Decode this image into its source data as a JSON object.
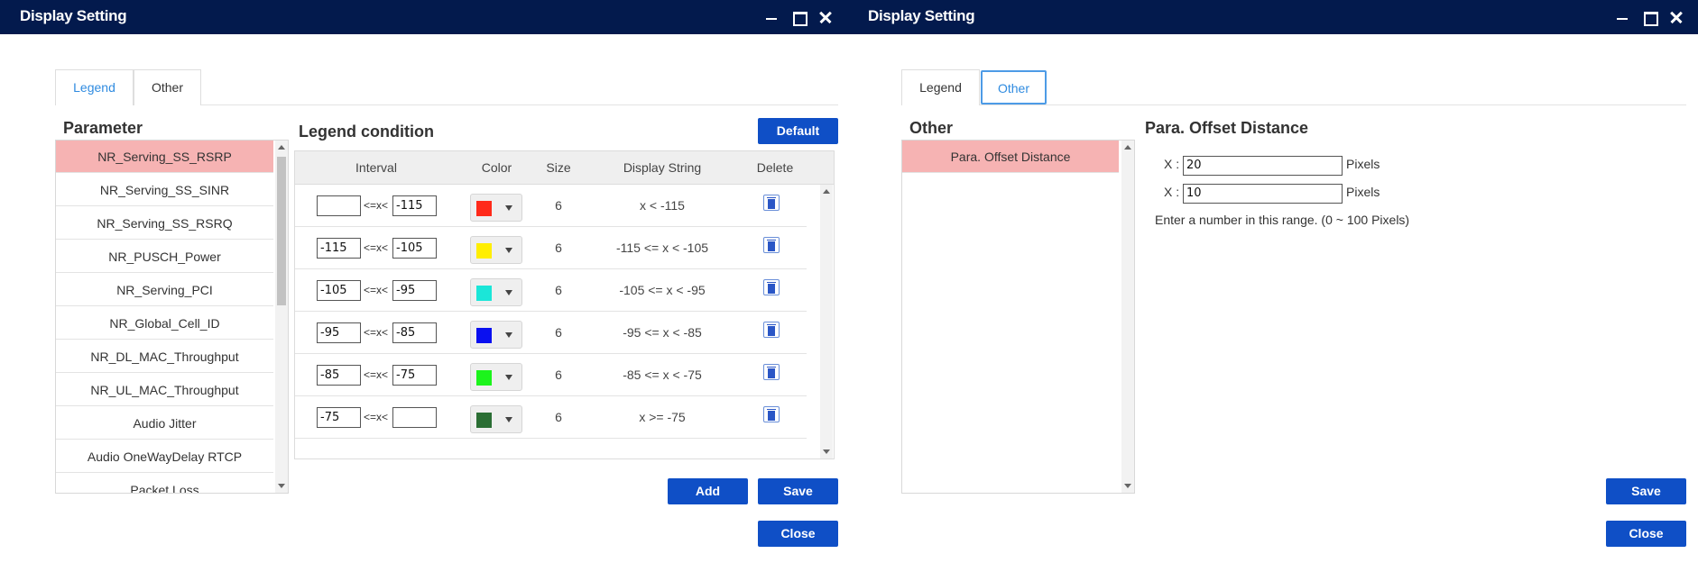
{
  "left_window": {
    "title": "Display Setting",
    "tabs": [
      {
        "label": "Legend"
      },
      {
        "label": "Other"
      }
    ],
    "parameter": {
      "heading": "Parameter",
      "items": [
        {
          "label": "NR_Serving_SS_RSRP"
        },
        {
          "label": "NR_Serving_SS_SINR"
        },
        {
          "label": "NR_Serving_SS_RSRQ"
        },
        {
          "label": "NR_PUSCH_Power"
        },
        {
          "label": "NR_Serving_PCI"
        },
        {
          "label": "NR_Global_Cell_ID"
        },
        {
          "label": "NR_DL_MAC_Throughput"
        },
        {
          "label": "NR_UL_MAC_Throughput"
        },
        {
          "label": "Audio Jitter"
        },
        {
          "label": "Audio OneWayDelay RTCP"
        },
        {
          "label": "Packet Loss"
        }
      ],
      "selected_index": 0
    },
    "legend": {
      "heading": "Legend condition",
      "default_label": "Default",
      "columns": {
        "interval": "Interval",
        "color": "Color",
        "size": "Size",
        "display": "Display String",
        "delete": "Delete"
      },
      "operator": "<=x<",
      "rows": [
        {
          "from": "",
          "to": "-115",
          "color": "#ff2a1a",
          "size": "6",
          "display": "x < -115"
        },
        {
          "from": "-115",
          "to": "-105",
          "color": "#ffee00",
          "size": "6",
          "display": "-115 <= x < -105"
        },
        {
          "from": "-105",
          "to": "-95",
          "color": "#1be6d8",
          "size": "6",
          "display": "-105 <= x < -95"
        },
        {
          "from": "-95",
          "to": "-85",
          "color": "#0a10f0",
          "size": "6",
          "display": "-95 <= x < -85"
        },
        {
          "from": "-85",
          "to": "-75",
          "color": "#1cf41c",
          "size": "6",
          "display": "-85 <= x < -75"
        },
        {
          "from": "-75",
          "to": "",
          "color": "#2b6e34",
          "size": "6",
          "display": "x >= -75"
        }
      ]
    },
    "buttons": {
      "add": "Add",
      "save": "Save",
      "close": "Close"
    }
  },
  "right_window": {
    "title": "Display Setting",
    "tabs": [
      {
        "label": "Legend"
      },
      {
        "label": "Other"
      }
    ],
    "other": {
      "heading": "Other",
      "items": [
        {
          "label": "Para. Offset Distance"
        }
      ]
    },
    "offset": {
      "heading": "Para. Offset Distance",
      "x_label": "X :",
      "fields": [
        {
          "value": "20",
          "unit": "Pixels"
        },
        {
          "value": "10",
          "unit": "Pixels"
        }
      ],
      "hint": "Enter a number in this range. (0 ~ 100 Pixels)"
    },
    "buttons": {
      "save": "Save",
      "close": "Close"
    }
  },
  "colors": {
    "titlebar": "#031a4d",
    "primary_button": "#0f4fc6",
    "selected_row": "#f6b3b3",
    "active_tab": "#2f8be0"
  }
}
